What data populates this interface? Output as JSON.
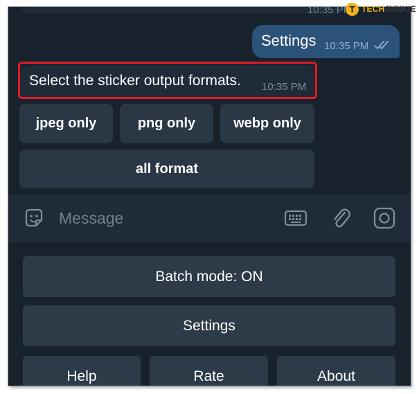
{
  "watermark": {
    "logo_letter": "T",
    "brand_part1": "TECH",
    "brand_part2": "JUNKIE"
  },
  "chat": {
    "previous_time": "10:35 PM",
    "outgoing": {
      "text": "Settings",
      "time": "10:35 PM",
      "status_icon": "double-check-icon"
    },
    "incoming": {
      "text": "Select the sticker output formats.",
      "time": "10:35 PM"
    },
    "inline_buttons": [
      {
        "label": "jpeg only"
      },
      {
        "label": "png only"
      },
      {
        "label": "webp only"
      },
      {
        "label": "all format"
      }
    ]
  },
  "input": {
    "placeholder": "Message",
    "icons": [
      "sticker-icon",
      "keyboard-icon",
      "attach-icon",
      "camera-icon"
    ]
  },
  "reply_keyboard": {
    "rows": [
      [
        {
          "label": "Batch mode: ON"
        }
      ],
      [
        {
          "label": "Settings"
        }
      ],
      [
        {
          "label": "Help"
        },
        {
          "label": "Rate"
        },
        {
          "label": "About"
        }
      ]
    ]
  },
  "colors": {
    "background": "#18222d",
    "bubble_out": "#2b5278",
    "bubble_in": "#1f2b38",
    "button": "#2a3744",
    "highlight_border": "#e01b24",
    "watermark_accent": "#f2b01e"
  }
}
